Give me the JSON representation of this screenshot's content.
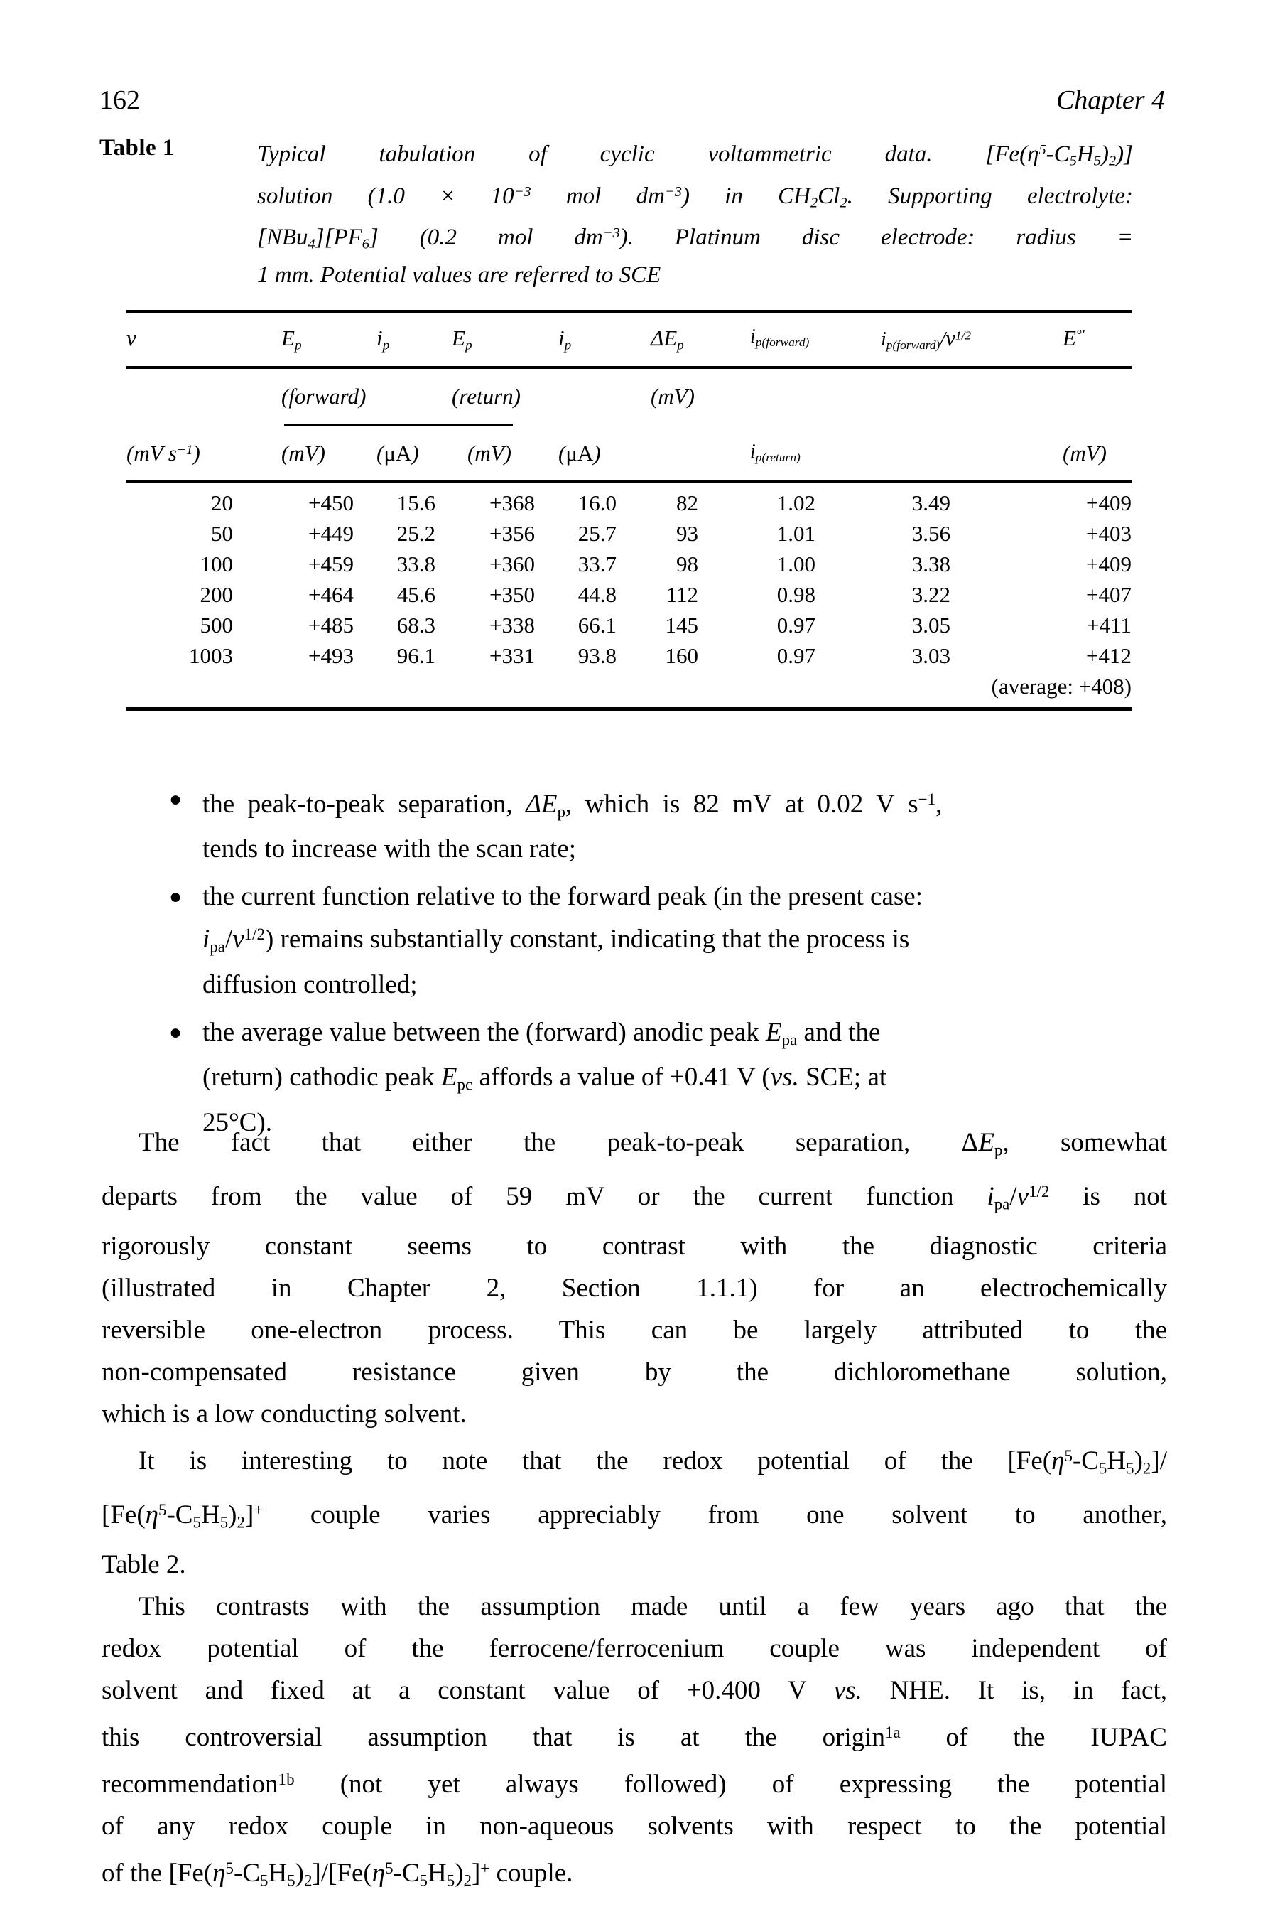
{
  "runhead": {
    "folio": "162",
    "chapter": "Chapter 4"
  },
  "table": {
    "label": "Table 1",
    "caption_lines": [
      "Typical tabulation of cyclic voltammetric data. [Fe(η5-C5H5)2)]",
      "solution (1.0 × 10−3 mol dm−3) in CH2Cl2. Supporting electrolyte:",
      "[NBu4][PF6] (0.2 mol dm−3). Platinum disc electrode: radius =",
      "1 mm. Potential values are referred to SCE"
    ],
    "caption_plain": "Typical tabulation of cyclic voltammetric data. [Fe(η⁵-C₅H₅)₂)] solution (1.0 × 10⁻³ mol dm⁻³) in CH₂Cl₂. Supporting electrolyte: [NBu₄][PF₆] (0.2 mol dm⁻³). Platinum disc electrode: radius = 1 mm. Potential values are referred to SCE",
    "header_row1": {
      "c0": "v",
      "c1": "Ep",
      "c2": "ip",
      "c3": "Ep",
      "c4": "ip",
      "c5": "ΔEp",
      "c6": "ip(forward)",
      "c7": "ip(forward)/v1/2",
      "c8": "E°′"
    },
    "header_row2": {
      "c1": "(forward)",
      "c3": "(return)",
      "c5": "(mV)"
    },
    "header_row3": {
      "c0": "(mV s−1)",
      "c1": "(mV)",
      "c2": "(μA)",
      "c3": "(mV)",
      "c4": "(μA)",
      "c6": "ip(return)",
      "c8": "(mV)"
    },
    "columns": [
      "v (mV s⁻¹)",
      "Ep (forward) (mV)",
      "ip (forward) (μA)",
      "Ep (return) (mV)",
      "ip (return) (μA)",
      "ΔEp (mV)",
      "ip(forward)/ip(return)",
      "ip(forward)/v¹ᐟ²",
      "E°′ (mV)"
    ],
    "rows": [
      [
        "20",
        "+450",
        "15.6",
        "+368",
        "16.0",
        "82",
        "1.02",
        "3.49",
        "+409"
      ],
      [
        "50",
        "+449",
        "25.2",
        "+356",
        "25.7",
        "93",
        "1.01",
        "3.56",
        "+403"
      ],
      [
        "100",
        "+459",
        "33.8",
        "+360",
        "33.7",
        "98",
        "1.00",
        "3.38",
        "+409"
      ],
      [
        "200",
        "+464",
        "45.6",
        "+350",
        "44.8",
        "112",
        "0.98",
        "3.22",
        "+407"
      ],
      [
        "500",
        "+485",
        "68.3",
        "+338",
        "66.1",
        "145",
        "0.97",
        "3.05",
        "+411"
      ],
      [
        "1003",
        "+493",
        "96.1",
        "+331",
        "93.8",
        "160",
        "0.97",
        "3.03",
        "+412"
      ]
    ],
    "footer_note": "(average: +408)"
  },
  "bullets": [
    {
      "lines": [
        "the peak-to-peak separation, ΔEp, which is 82 mV at 0.02 V s−1,",
        "tends to increase with the scan rate;"
      ]
    },
    {
      "lines": [
        "the current function relative to the forward peak (in the present case:",
        "ipa/v1/2) remains substantially constant, indicating that the process is",
        "diffusion controlled;"
      ]
    },
    {
      "lines": [
        "the average value between the (forward) anodic peak Epa and the",
        "(return) cathodic peak Epc affords a value of +0.41 V (vs. SCE; at",
        "25°C)."
      ]
    }
  ],
  "paragraphs": [
    {
      "lines": [
        "The fact that either the peak-to-peak separation, ΔEp, somewhat",
        "departs from the value of 59 mV or the current function ipa/v1/2 is not",
        "rigorously constant seems to contrast with the diagnostic criteria",
        "(illustrated in Chapter 2, Section 1.1.1) for an electrochemically",
        "reversible one-electron process. This can be largely attributed to the",
        "non-compensated resistance given by the dichloromethane solution,",
        "which is a low conducting solvent."
      ]
    },
    {
      "lines": [
        "It is interesting to note that the redox potential of the [Fe(η5-C5H5)2]/",
        "[Fe(η5-C5H5)2]+ couple varies appreciably from one solvent to another,",
        "Table 2."
      ]
    },
    {
      "lines": [
        "This contrasts with the assumption made until a few years ago that the",
        "redox potential of the ferrocene/ferrocenium couple was independent of",
        "solvent and fixed at a constant value of +0.400 V vs. NHE. It is, in fact,",
        "this controversial assumption that is at the origin1a of the IUPAC",
        "recommendation1b (not yet always followed) of expressing the potential",
        "of any redox couple in non-aqueous solvents with respect to the potential",
        "of the [Fe(η5-C5H5)2]/[Fe(η5-C5H5)2]+ couple."
      ]
    }
  ]
}
